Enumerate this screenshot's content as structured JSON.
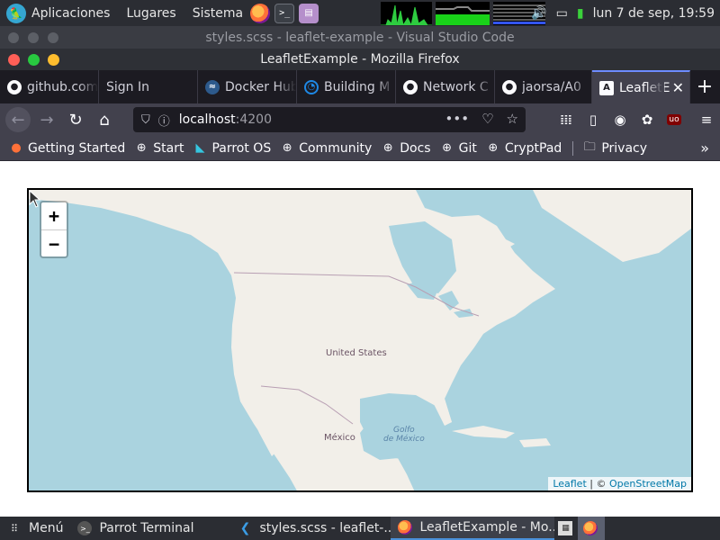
{
  "os_panel": {
    "menu_apps": "Aplicaciones",
    "menu_places": "Lugares",
    "menu_system": "Sistema",
    "clock": "lun 7 de sep, 19:59"
  },
  "vscode": {
    "title": "styles.scss - leaflet-example - Visual Studio Code"
  },
  "firefox": {
    "title": "LeafletExample - Mozilla Firefox",
    "tabs": [
      {
        "label": "github.com",
        "icon": "github-icon"
      },
      {
        "label": "Sign In",
        "icon": "none"
      },
      {
        "label": "Docker Hub",
        "icon": "docker-icon"
      },
      {
        "label": "Building M",
        "icon": "building-icon"
      },
      {
        "label": "Network C",
        "icon": "github-icon"
      },
      {
        "label": "jaorsa/A0",
        "icon": "github-icon"
      },
      {
        "label": "LeafletE",
        "icon": "angular-icon",
        "active": true
      }
    ],
    "url_host": "localhost",
    "url_port": ":4200",
    "bookmarks": [
      {
        "label": "Getting Started",
        "icon": "firefox-icon"
      },
      {
        "label": "Start",
        "icon": "globe-icon"
      },
      {
        "label": "Parrot OS",
        "icon": "parrot-icon"
      },
      {
        "label": "Community",
        "icon": "globe-icon"
      },
      {
        "label": "Docs",
        "icon": "globe-icon"
      },
      {
        "label": "Git",
        "icon": "globe-icon"
      },
      {
        "label": "CryptPad",
        "icon": "globe-icon"
      }
    ],
    "bookmark_folder": "Privacy"
  },
  "map": {
    "zoom_in": "+",
    "zoom_out": "−",
    "labels": {
      "us": "United States",
      "mexico": "México",
      "gulf_line1": "Golfo",
      "gulf_line2": "de México"
    },
    "attribution_leaflet": "Leaflet",
    "attribution_sep": " | © ",
    "attribution_osm": "OpenStreetMap"
  },
  "taskbar": {
    "menu": "Menú",
    "tasks": [
      {
        "label": "Parrot Terminal"
      },
      {
        "label": "styles.scss - leaflet-..."
      },
      {
        "label": "LeafletExample - Mo..."
      }
    ]
  },
  "colors": {
    "water": "#aad3df",
    "land": "#f2efe9",
    "accent": "#6d8bff"
  }
}
